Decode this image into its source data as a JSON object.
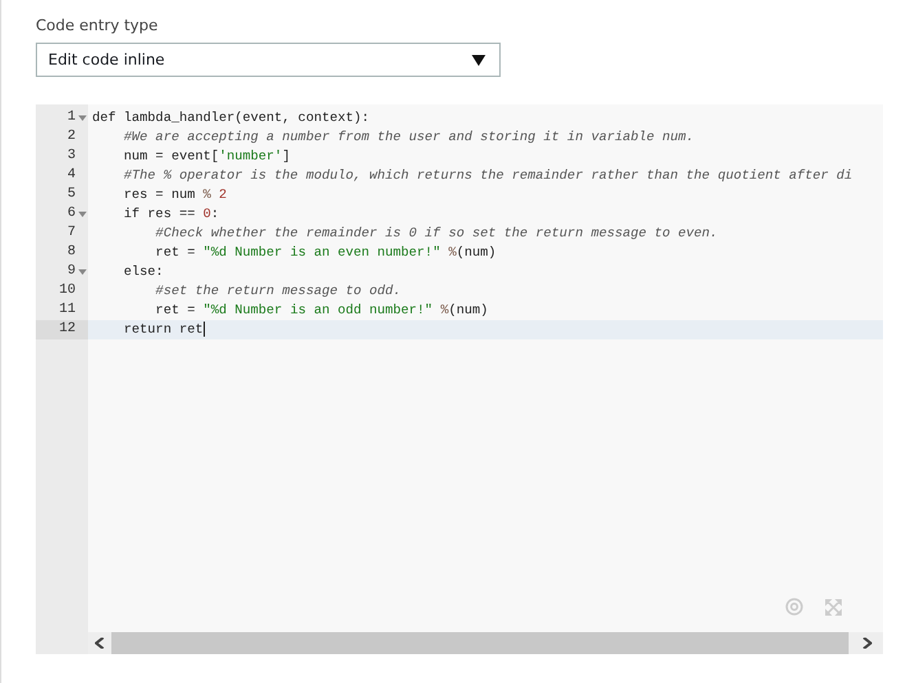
{
  "code_entry_type": {
    "label": "Code entry type",
    "value": "Edit code inline"
  },
  "editor": {
    "lines": [
      {
        "number": "1",
        "foldable": true,
        "active": false,
        "tokens": [
          {
            "kind": "plain",
            "text": "def lambda_handler(event, context):"
          }
        ]
      },
      {
        "number": "2",
        "foldable": false,
        "active": false,
        "tokens": [
          {
            "kind": "comment",
            "text": "    #We are accepting a number from the user and storing it in variable num."
          }
        ]
      },
      {
        "number": "3",
        "foldable": false,
        "active": false,
        "tokens": [
          {
            "kind": "plain",
            "text": "    num = event["
          },
          {
            "kind": "string",
            "text": "'number'"
          },
          {
            "kind": "plain",
            "text": "]"
          }
        ]
      },
      {
        "number": "4",
        "foldable": false,
        "active": false,
        "tokens": [
          {
            "kind": "comment",
            "text": "    #The % operator is the modulo, which returns the remainder rather than the quotient after di"
          }
        ]
      },
      {
        "number": "5",
        "foldable": false,
        "active": false,
        "tokens": [
          {
            "kind": "plain",
            "text": "    res = num "
          },
          {
            "kind": "operator",
            "text": "%"
          },
          {
            "kind": "number",
            "text": " 2"
          }
        ]
      },
      {
        "number": "6",
        "foldable": true,
        "active": false,
        "tokens": [
          {
            "kind": "plain",
            "text": "    if res == "
          },
          {
            "kind": "number",
            "text": "0"
          },
          {
            "kind": "plain",
            "text": ":"
          }
        ]
      },
      {
        "number": "7",
        "foldable": false,
        "active": false,
        "tokens": [
          {
            "kind": "comment",
            "text": "        #Check whether the remainder is 0 if so set the return message to even."
          }
        ]
      },
      {
        "number": "8",
        "foldable": false,
        "active": false,
        "tokens": [
          {
            "kind": "plain",
            "text": "        ret = "
          },
          {
            "kind": "string",
            "text": "\"%d Number is an even number!\""
          },
          {
            "kind": "operator",
            "text": " %"
          },
          {
            "kind": "plain",
            "text": "(num)"
          }
        ]
      },
      {
        "number": "9",
        "foldable": true,
        "active": false,
        "tokens": [
          {
            "kind": "plain",
            "text": "    else:"
          }
        ]
      },
      {
        "number": "10",
        "foldable": false,
        "active": false,
        "tokens": [
          {
            "kind": "comment",
            "text": "        #set the return message to odd."
          }
        ]
      },
      {
        "number": "11",
        "foldable": false,
        "active": false,
        "tokens": [
          {
            "kind": "plain",
            "text": "        ret = "
          },
          {
            "kind": "string",
            "text": "\"%d Number is an odd number!\""
          },
          {
            "kind": "operator",
            "text": " %"
          },
          {
            "kind": "plain",
            "text": "(num)"
          }
        ]
      },
      {
        "number": "12",
        "foldable": false,
        "active": true,
        "tokens": [
          {
            "kind": "plain",
            "text": "    return ret"
          }
        ]
      }
    ]
  }
}
